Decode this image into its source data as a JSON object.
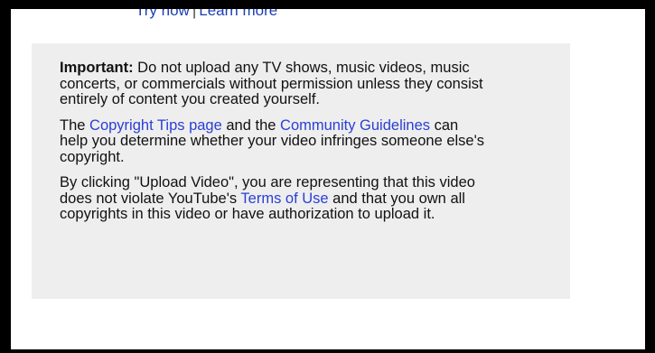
{
  "top_links": {
    "try_now": "Try now",
    "separator": "|",
    "learn_more": "Learn more"
  },
  "notice": {
    "important": {
      "label": "Important:",
      "text": " Do not upload any TV shows, music videos, music concerts, or commercials without permission unless they consist entirely of content you created yourself."
    },
    "copyright": {
      "pre": "The ",
      "link1": "Copyright Tips page",
      "mid": " and the ",
      "link2": "Community Guidelines",
      "post": " can help you determine whether your video infringes someone else's copyright."
    },
    "terms": {
      "pre": "By clicking \"Upload Video\", you are representing that this video does not violate YouTube's ",
      "link": "Terms of Use",
      "post": " and that you own all copyrights in this video or have authorization to upload it."
    }
  },
  "colors": {
    "link": "#2a3fd6",
    "panel_bg": "#eeeeee",
    "frame": "#000000"
  }
}
